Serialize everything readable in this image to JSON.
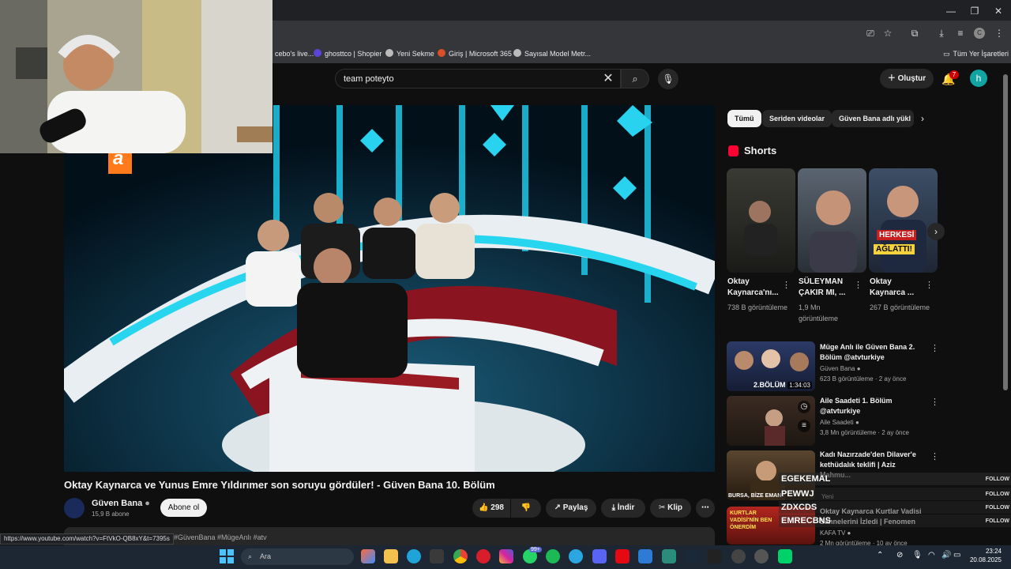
{
  "browser": {
    "bookmarks": [
      {
        "label": "cebo's live...",
        "icon": "globe-icon"
      },
      {
        "label": "ghosttco | Shopier",
        "icon": "shopier-icon"
      },
      {
        "label": "Yeni Sekme",
        "icon": "globe-icon"
      },
      {
        "label": "Giriş | Microsoft 365",
        "icon": "microsoft-icon"
      },
      {
        "label": "Sayısal Model Metr...",
        "icon": "globe-icon"
      }
    ],
    "all_bookmarks": "Tüm Yer İşaretleri",
    "profile_initial": "C",
    "status_url": "https://www.youtube.com/watch?v=FtVkO-QB8xY&t=7395s"
  },
  "header": {
    "search_value": "team poteyto",
    "create_label": "Oluştur",
    "notif_count": "7",
    "avatar_initial": "h"
  },
  "video": {
    "title": "Oktay Kaynarca ve Yunus Emre Yıldırımer son soruyu gördüler! - Güven Bana 10. Bölüm",
    "channel": "Güven Bana",
    "subscribers": "15,9 B abone",
    "subscribe_label": "Abone ol",
    "likes": "298",
    "share_label": "Paylaş",
    "download_label": "İndir",
    "clip_label": "Klip",
    "tags": "#GüvenBana #MügeAnlı #atv",
    "logo": "a"
  },
  "sidebar": {
    "chips": [
      "Tümü",
      "Seriden videolar",
      "Güven Bana adlı yükl"
    ],
    "shorts_label": "Shorts",
    "shorts": [
      {
        "title": "Oktay Kaynarca'nı...",
        "views": "738 B görüntüleme"
      },
      {
        "title": "SÜLEYMAN ÇAKIR MI, ...",
        "views": "1,9 Mn görüntüleme"
      },
      {
        "title": "Oktay Kaynarca ...",
        "views": "267 B görüntüleme",
        "overlay1": "HERKESİ",
        "overlay2": "AĞLATTI!"
      }
    ],
    "videos": [
      {
        "title": "Müge Anlı ile Güven Bana 2. Bölüm @atvturkiye",
        "channel": "Güven Bana",
        "meta": "623 B görüntüleme · 2 ay önce",
        "duration": "1:34:03",
        "thumb_text": "2.BÖLÜM"
      },
      {
        "title": "Aile Saadeti 1. Bölüm @atvturkiye",
        "channel": "Aile Saadeti",
        "meta": "3,8 Mn görüntüleme · 2 ay önce"
      },
      {
        "title": "Kadı Nazırzade'den Dilaver'e kethüdalık teklifi | Aziz Mahmu...",
        "channel": "",
        "meta": "",
        "thumb_text": "BURSA, BİZE EMAN"
      },
      {
        "title": "Oktay Kaynarca Kurtlar Vadisi Sahnelerini İzledi | Fenomen",
        "channel": "KAFA TV",
        "meta": "2 Mn görüntüleme · 10 ay önce",
        "thumb_text": "KURTLAR VADİSİ'NİN BEN ÖNERDİM"
      }
    ]
  },
  "chat": [
    {
      "name": "EGEKEMAL",
      "tag": "FOLLOW"
    },
    {
      "name": "PEWWJ",
      "tag": "FOLLOW"
    },
    {
      "name": "ZDXCDS",
      "tag": "FOLLOW"
    },
    {
      "name": "EMRECBNS",
      "tag": "FOLLOW"
    }
  ],
  "chat_under": {
    "text1": "Yeni"
  },
  "taskbar": {
    "search_label": "Ara",
    "whatsapp_badge": "99+",
    "time": "23:24",
    "date": "20.08.2025"
  }
}
